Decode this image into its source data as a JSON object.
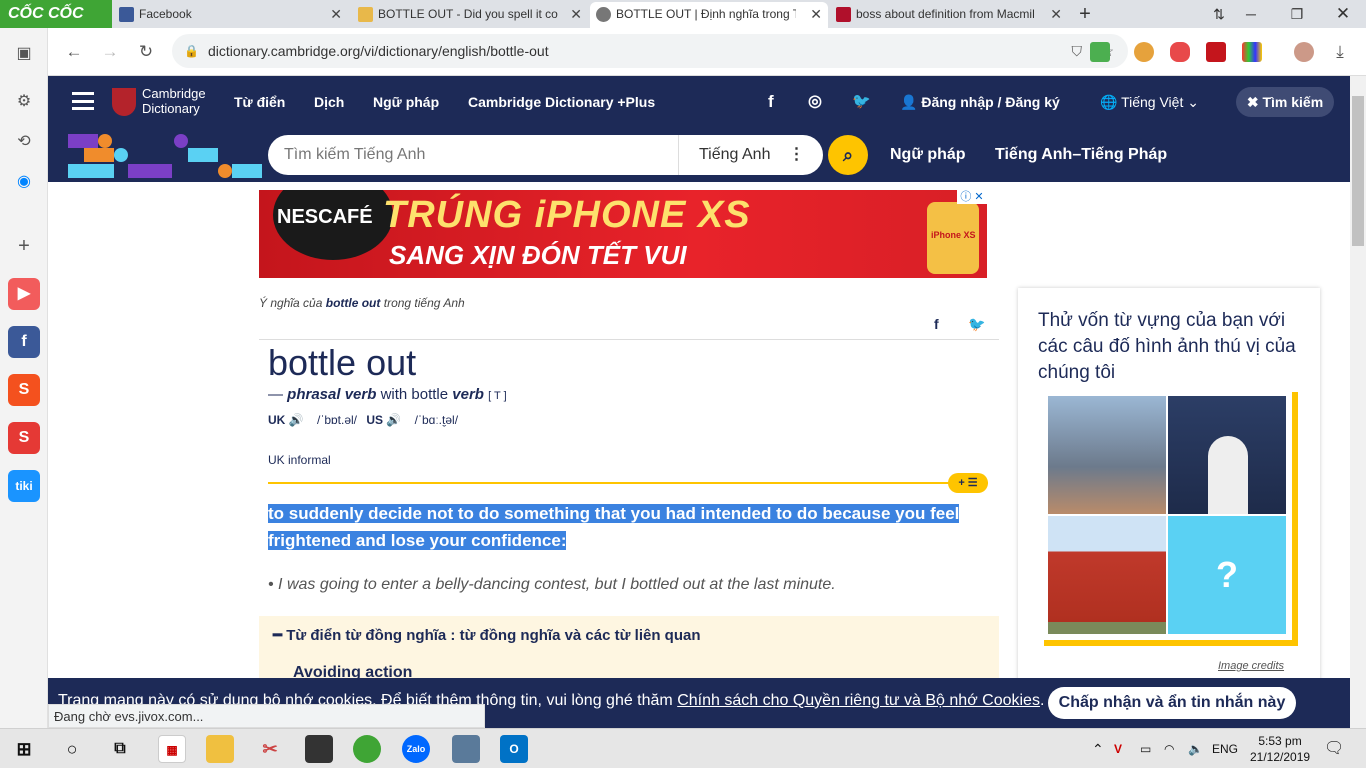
{
  "browser": {
    "brand": "CỐC CỐC",
    "tabs": [
      {
        "title": "Facebook"
      },
      {
        "title": "BOTTLE OUT - Did you spell it corr"
      },
      {
        "title": "BOTTLE OUT | Định nghĩa trong Từ"
      },
      {
        "title": "boss about definition from Macmil"
      }
    ],
    "url": "dictionary.cambridge.org/vi/dictionary/english/bottle-out",
    "status": "Đang chờ evs.jivox.com..."
  },
  "header": {
    "logo_line1": "Cambridge",
    "logo_line2": "Dictionary",
    "menu": [
      "Từ điển",
      "Dịch",
      "Ngữ pháp",
      "Cambridge Dictionary +Plus"
    ],
    "login": "Đăng nhập / Đăng ký",
    "language": "Tiếng Việt",
    "search_label": "Tìm kiếm"
  },
  "subheader": {
    "search_placeholder": "Tìm kiếm Tiếng Anh",
    "search_lang": "Tiếng Anh",
    "link1": "Ngữ pháp",
    "link2": "Tiếng Anh–Tiếng Pháp"
  },
  "ad": {
    "logo": "NESCAFÉ",
    "line1": "TRÚNG iPHONE XS",
    "line2": "SANG XỊN ĐÓN TẾT VUI",
    "phone": "iPhone XS"
  },
  "entry": {
    "crumb_prefix": "Ý nghĩa của",
    "crumb_word": "bottle out",
    "crumb_suffix": "trong tiếng Anh",
    "headword": "bottle out",
    "pos_dash": "—",
    "pos": "phrasal verb",
    "pos_with": "with bottle",
    "pos_verb": "verb",
    "grammar": "[ T ]",
    "uk": "UK",
    "uk_ipa": "/ˈbɒt.əl/",
    "us": "US",
    "us_ipa": "/ˈbɑː.t̬əl/",
    "register": "UK informal",
    "definition": "to suddenly decide not to do something that you had intended to do because you feel frightened and lose your confidence:",
    "example": "I was going to enter a belly-dancing contest, but I bottled out at the last minute.",
    "synonyms_heading": "Từ điển từ đồng nghĩa : từ đồng nghĩa và các từ liên quan",
    "synonyms_first": "Avoiding action"
  },
  "quiz": {
    "title": "Thử vốn từ vựng của bạn với các câu đố hình ảnh thú vị của chúng tôi",
    "credits": "Image credits",
    "unknown": "?"
  },
  "cookie": {
    "text": "Trang mạng này có sử dụng bộ nhớ cookies. Để biết thêm thông tin, vui lòng ghé thăm",
    "link": "Chính sách cho Quyền riêng tư và Bộ nhớ Cookies",
    "button": "Chấp nhận và ẩn tin nhắn này"
  },
  "taskbar": {
    "lang": "ENG",
    "time": "5:53 pm",
    "date": "21/12/2019",
    "zalo": "Zalo"
  },
  "colors": {
    "navy": "#1d2a57",
    "yellow": "#fec400",
    "highlight": "#3b82e0"
  }
}
